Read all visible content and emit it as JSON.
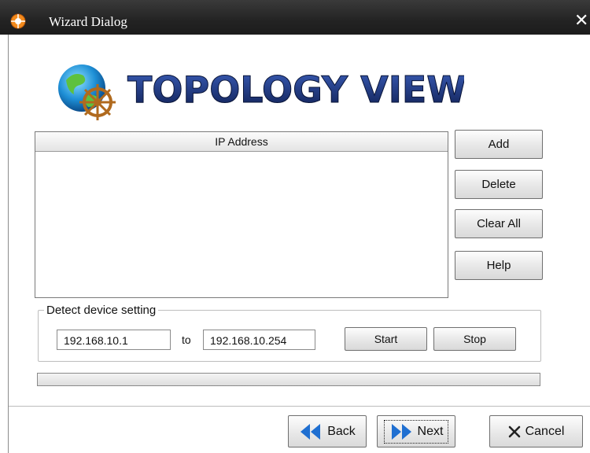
{
  "window": {
    "title": "Wizard Dialog",
    "close_glyph": "✕"
  },
  "banner": {
    "text": "TOPOLOGY VIEW",
    "icon": "globe-helm-logo"
  },
  "ip_table": {
    "column_header": "IP Address",
    "rows": []
  },
  "side_buttons": {
    "add": "Add",
    "delete": "Delete",
    "clear_all": "Clear All",
    "help": "Help"
  },
  "detect": {
    "legend": "Detect device setting",
    "from_ip": "192.168.10.1",
    "to_label": "to",
    "to_ip": "192.168.10.254",
    "start": "Start",
    "stop": "Stop",
    "progress": 0
  },
  "nav": {
    "back": "Back",
    "next": "Next",
    "cancel": "Cancel"
  },
  "colors": {
    "arrow_blue": "#1f6fd1",
    "title_dark": "#1c2f6b"
  }
}
